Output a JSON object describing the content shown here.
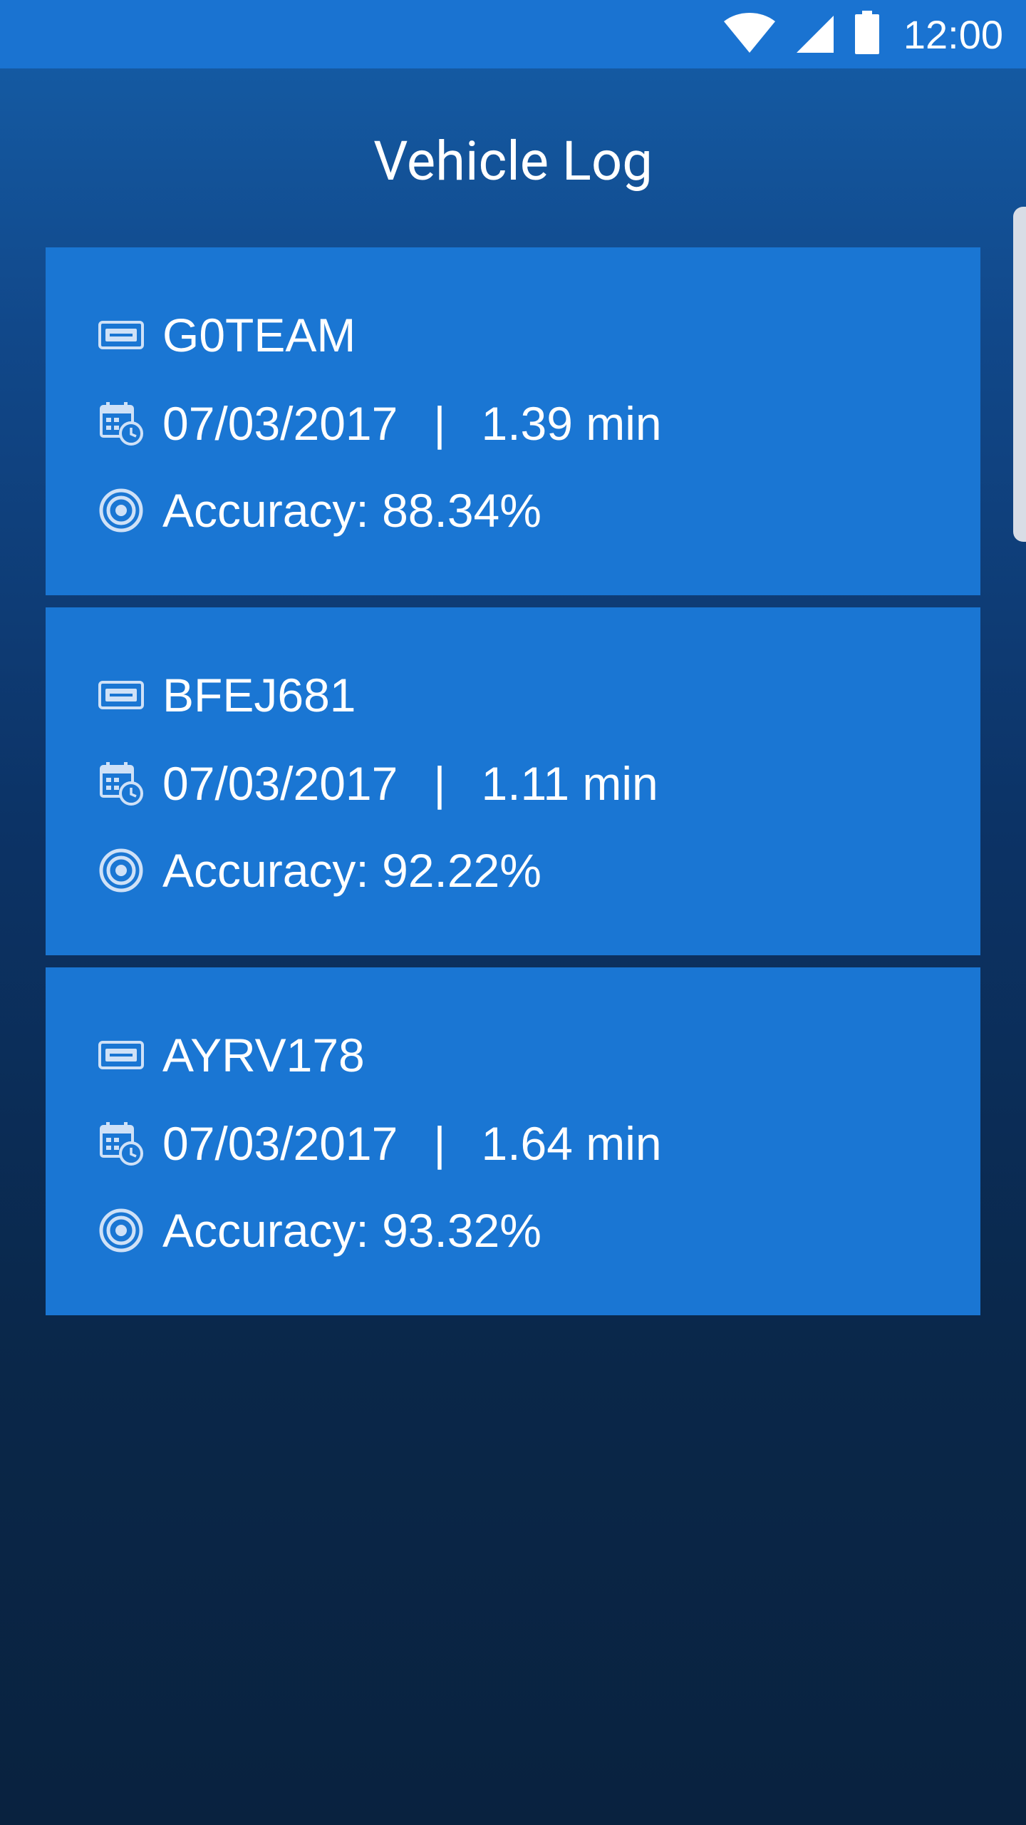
{
  "status_bar": {
    "time": "12:00",
    "icons": [
      "wifi-icon",
      "signal-icon",
      "battery-icon"
    ],
    "color": "#1a73d1"
  },
  "header": {
    "title": "Vehicle Log"
  },
  "colors": {
    "card": "#1a76d3",
    "text": "#ffffff"
  },
  "logs": [
    {
      "plate": "G0TEAM",
      "date": "07/03/2017",
      "separator": "|",
      "duration": "1.39 min",
      "accuracy": "Accuracy: 88.34%"
    },
    {
      "plate": "BFEJ681",
      "date": "07/03/2017",
      "separator": "|",
      "duration": "1.11 min",
      "accuracy": "Accuracy: 92.22%"
    },
    {
      "plate": "AYRV178",
      "date": "07/03/2017",
      "separator": "|",
      "duration": "1.64 min",
      "accuracy": "Accuracy: 93.32%"
    }
  ]
}
